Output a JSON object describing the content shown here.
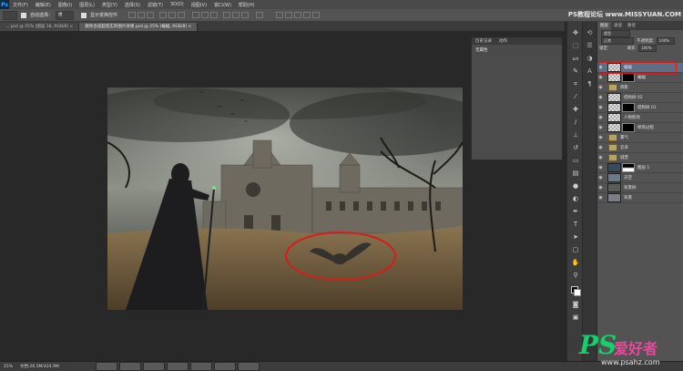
{
  "app": {
    "logo": "Ps"
  },
  "menubar": {
    "items": [
      "文件(F)",
      "编辑(E)",
      "图像(I)",
      "图层(L)",
      "类型(Y)",
      "选择(S)",
      "滤镜(T)",
      "3D(D)",
      "视图(V)",
      "窗口(W)",
      "帮助(H)"
    ],
    "window_controls": [
      "—",
      "□",
      "✕"
    ]
  },
  "options": {
    "auto_select_label": "自动选择：",
    "auto_select_value": "组",
    "show_transform_label": "显示变换控件"
  },
  "tabs": [
    {
      "label": "... psd @ 25% (图层 18, RGB/8) ×",
      "active": false
    },
    {
      "label": "教你合成超现实的图片效果.psd @ 25% (蝙蝠, RGB/8) ×",
      "active": true
    }
  ],
  "history_panel": {
    "tabs": [
      "历史记录",
      "动作"
    ],
    "entry": "无属性"
  },
  "layers_panel": {
    "tabs": [
      "图层",
      "通道",
      "路径"
    ],
    "kind_label": "类型",
    "blend_mode": "正常",
    "opacity_label": "不透明度:",
    "opacity_value": "100%",
    "lock_label": "锁定:",
    "fill_label": "填充:",
    "fill_value": "100%",
    "layers": [
      {
        "name": "蝙蝠",
        "type": "pixel",
        "selected": true
      },
      {
        "name": "蝙蝠",
        "type": "pixel-mask"
      },
      {
        "name": "阴影",
        "type": "group"
      },
      {
        "name": "结构树 02",
        "type": "pixel"
      },
      {
        "name": "结构树 01",
        "type": "pixel-mask"
      },
      {
        "name": "人物照亮",
        "type": "pixel"
      },
      {
        "name": "修饰过程",
        "type": "pixel-mask"
      },
      {
        "name": "雾气",
        "type": "group"
      },
      {
        "name": "云朵",
        "type": "group"
      },
      {
        "name": "城堡",
        "type": "group"
      },
      {
        "name": "图层 1",
        "type": "pixel-mask"
      },
      {
        "name": "天空",
        "type": "pixel"
      },
      {
        "name": "背景树",
        "type": "pixel"
      },
      {
        "name": "背景",
        "type": "pixel"
      }
    ]
  },
  "statusbar": {
    "zoom": "25%",
    "doc": "文档:26.5M/424.9M"
  },
  "watermark": {
    "top": "PS教程论坛 www.MISSYUAN.COM",
    "ps": "PS",
    "cn": "爱好者",
    "url": "www.psahz.com"
  },
  "colors": {
    "highlight": "#d81b1b",
    "selected_layer": "#5f6e84",
    "wm_green": "#15d06c",
    "wm_pink": "#e34b9a"
  }
}
